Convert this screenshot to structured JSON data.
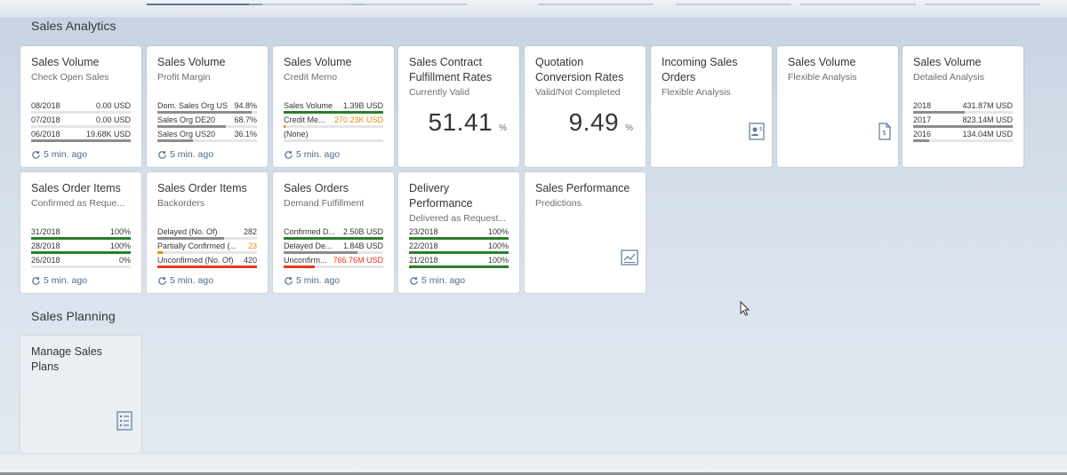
{
  "sections": {
    "analytics_title": "Sales Analytics",
    "planning_title": "Sales Planning"
  },
  "colors": {
    "good": "#2b7d2b",
    "warning": "#e78c07",
    "error": "#e9361a",
    "neutral": "#8c8c8c",
    "link": "#4b6a88"
  },
  "refresh_label": "5 min. ago",
  "tiles": {
    "check_open_sales": {
      "title": "Sales Volume",
      "subtitle": "Check Open Sales",
      "rows": [
        {
          "label": "08/2018",
          "value": "0.00 USD"
        },
        {
          "label": "07/2018",
          "value": "0.00 USD"
        },
        {
          "label": "06/2018",
          "value": "19.68K USD"
        }
      ]
    },
    "profit_margin": {
      "title": "Sales Volume",
      "subtitle": "Profit Margin",
      "rows": [
        {
          "label": "Dom. Sales Org US",
          "value": "94.8%"
        },
        {
          "label": "Sales Org DE20",
          "value": "68.7%"
        },
        {
          "label": "Sales Org US20",
          "value": "36.1%"
        }
      ]
    },
    "credit_memo": {
      "title": "Sales Volume",
      "subtitle": "Credit Memo",
      "rows": [
        {
          "label": "Sales Volume",
          "value": "1.39B USD"
        },
        {
          "label": "Credit Me...",
          "value": "270.23K USD"
        },
        {
          "label": "(None)",
          "value": ""
        }
      ]
    },
    "contract_fulfillment": {
      "title": "Sales Contract Fulfillment Rates",
      "subtitle": "Currently Valid",
      "kpi": "51.41",
      "unit": "%"
    },
    "quotation_conversion": {
      "title": "Quotation Conversion Rates",
      "subtitle": "Valid/Not Completed",
      "kpi": "9.49",
      "unit": "%"
    },
    "incoming_orders": {
      "title": "Incoming Sales Orders",
      "subtitle": "Flexible Analysis",
      "icon": "user-report-icon"
    },
    "flexible_analysis": {
      "title": "Sales Volume",
      "subtitle": "Flexible Analysis",
      "icon": "document-dollar-icon"
    },
    "detailed_analysis": {
      "title": "Sales Volume",
      "subtitle": "Detailed Analysis",
      "rows": [
        {
          "label": "2018",
          "value": "431.87M USD"
        },
        {
          "label": "2017",
          "value": "823.14M USD"
        },
        {
          "label": "2016",
          "value": "134.04M USD"
        }
      ]
    },
    "order_items_confirmed": {
      "title": "Sales Order Items",
      "subtitle": "Confirmed as Reque...",
      "rows": [
        {
          "label": "31/2018",
          "value": "100%"
        },
        {
          "label": "28/2018",
          "value": "100%"
        },
        {
          "label": "26/2018",
          "value": "0%"
        }
      ]
    },
    "order_items_backorders": {
      "title": "Sales Order Items",
      "subtitle": "Backorders",
      "rows": [
        {
          "label": "Delayed (No. Of)",
          "value": "282"
        },
        {
          "label": "Partially Confirmed (...",
          "value": "23"
        },
        {
          "label": "Unconfirmed (No. Of)",
          "value": "420"
        }
      ]
    },
    "demand_fulfillment": {
      "title": "Sales Orders",
      "subtitle": "Demand Fulfillment",
      "rows": [
        {
          "label": "Confirmed D...",
          "value": "2.50B USD"
        },
        {
          "label": "Delayed De...",
          "value": "1.84B USD"
        },
        {
          "label": "Unconfirm...",
          "value": "766.76M USD"
        }
      ]
    },
    "delivery_performance": {
      "title": "Delivery Performance",
      "subtitle": "Delivered as Request...",
      "rows": [
        {
          "label": "23/2018",
          "value": "100%"
        },
        {
          "label": "22/2018",
          "value": "100%"
        },
        {
          "label": "21/2018",
          "value": "100%"
        }
      ]
    },
    "sales_performance": {
      "title": "Sales Performance",
      "subtitle": "Predictions",
      "icon": "chart-report-icon"
    },
    "manage_sales_plans": {
      "title": "Manage Sales Plans",
      "icon": "list-icon"
    }
  }
}
